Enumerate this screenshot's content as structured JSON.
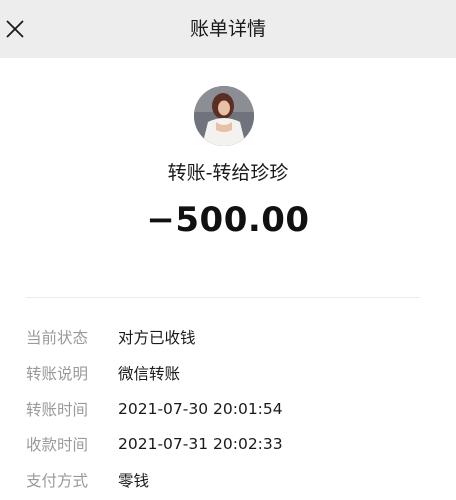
{
  "header": {
    "title": "账单详情",
    "close_icon": "close-icon"
  },
  "transfer": {
    "title": "转账-转给珍珍",
    "amount": "−500.00"
  },
  "details": [
    {
      "label": "当前状态",
      "value": "对方已收钱"
    },
    {
      "label": "转账说明",
      "value": "微信转账"
    },
    {
      "label": "转账时间",
      "value": "2021-07-30 20:01:54"
    },
    {
      "label": "收款时间",
      "value": "2021-07-31 20:02:33"
    },
    {
      "label": "支付方式",
      "value": "零钱"
    }
  ],
  "colors": {
    "header_bg": "#ededed",
    "label": "#9a9a9a",
    "text": "#191919"
  }
}
